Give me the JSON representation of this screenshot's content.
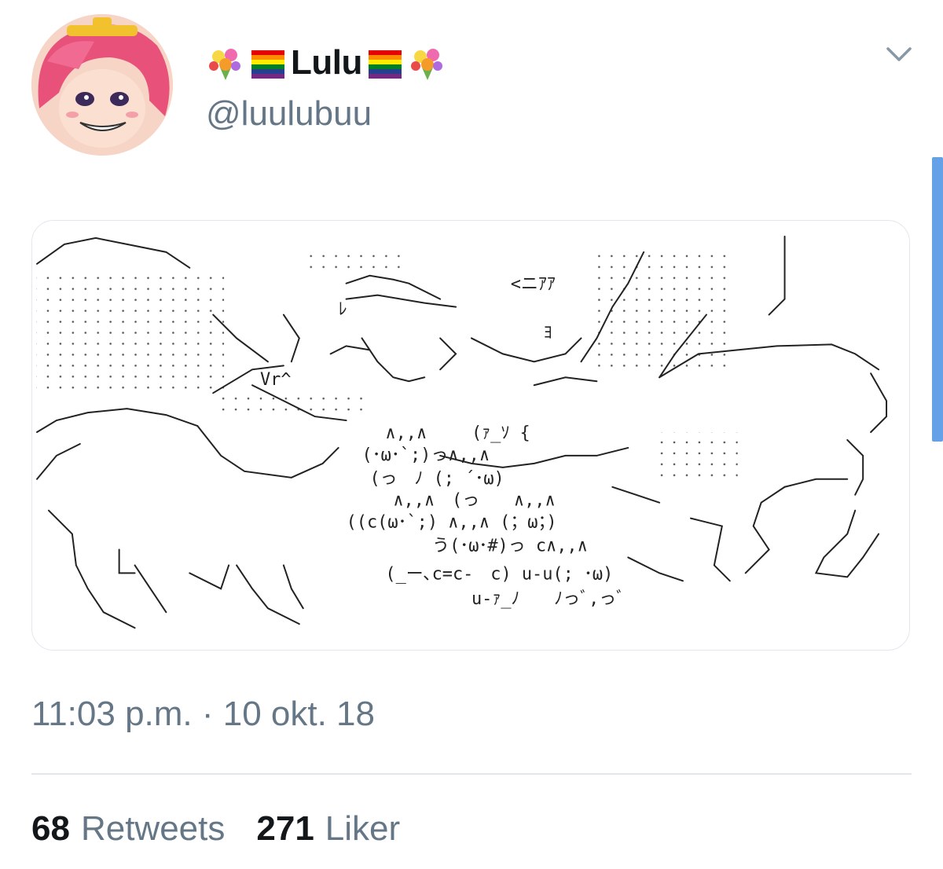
{
  "tweet": {
    "author": {
      "display_name": "Lulu",
      "handle": "@luulubuu",
      "name_emojis": [
        "bouquet-emoji",
        "rainbow-flag-emoji",
        "rainbow-flag-emoji",
        "bouquet-emoji"
      ]
    },
    "image": {
      "kaomoji": [
        "∧,,∧",
        "(ｧ_ｿ {",
        "(･ω･`;)っ∧,,∧",
        "(っ　ﾉ (; ´･ω)",
        "∧,,∧　(っ　　∧,,∧",
        "((c(ω･`;) ∧,,∧ (；ω；)",
        "う(･ω･#)っ c∧,,∧",
        "(_ー､c=c-　c) u-u(; ･ω)",
        "u-ｧ_ﾉ　　ﾉっﾞ,っﾞ",
        "<ニｱｱ",
        "Vr^",
        "ﾚ",
        "ﾖ"
      ]
    },
    "timestamp": "11:03 p.m. · 10 okt. 18",
    "stats": {
      "retweets_count": "68",
      "retweets_label": "Retweets",
      "likes_count": "271",
      "likes_label": "Liker"
    },
    "colors": {
      "text_primary": "#14171a",
      "text_secondary": "#657786",
      "border": "#e1e8ed",
      "scrollbar": "#4a90e2"
    }
  }
}
